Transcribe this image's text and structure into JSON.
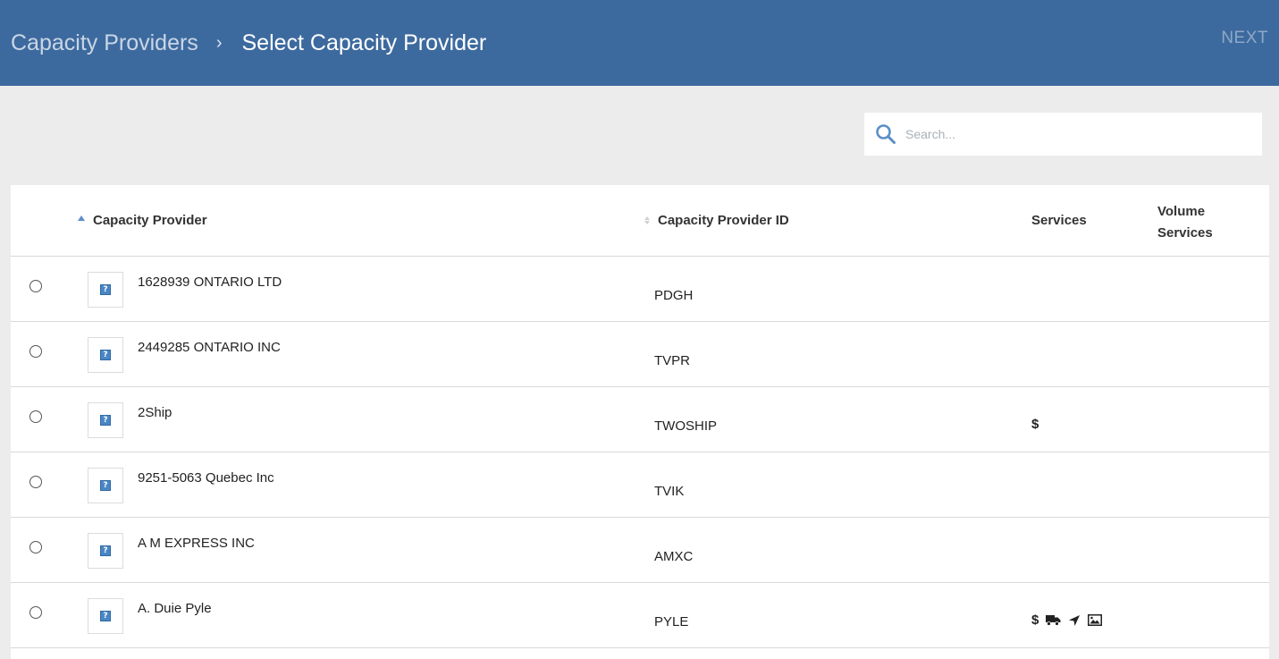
{
  "header": {
    "parent": "Capacity Providers",
    "separator": "›",
    "current": "Select Capacity Provider",
    "next_label": "NEXT"
  },
  "search": {
    "placeholder": "Search...",
    "icon": "search-icon"
  },
  "table": {
    "columns": {
      "name": "Capacity Provider",
      "id": "Capacity Provider ID",
      "services": "Services",
      "volume_line1": "Volume",
      "volume_line2": "Services"
    },
    "rows": [
      {
        "name": "1628939 ONTARIO LTD",
        "id": "PDGH",
        "services": ""
      },
      {
        "name": "2449285 ONTARIO INC",
        "id": "TVPR",
        "services": ""
      },
      {
        "name": "2Ship",
        "id": "TWOSHIP",
        "services": "$"
      },
      {
        "name": "9251-5063 Quebec Inc",
        "id": "TVIK",
        "services": ""
      },
      {
        "name": "A M EXPRESS INC",
        "id": "AMXC",
        "services": ""
      },
      {
        "name": "A. Duie Pyle",
        "id": "PYLE",
        "services": "$",
        "service_icons": [
          "truck-icon",
          "location-arrow-icon",
          "image-icon"
        ]
      }
    ]
  },
  "colors": {
    "header_bg": "#3d6a9e",
    "page_bg": "#ececec",
    "accent": "#5b8fc7"
  }
}
